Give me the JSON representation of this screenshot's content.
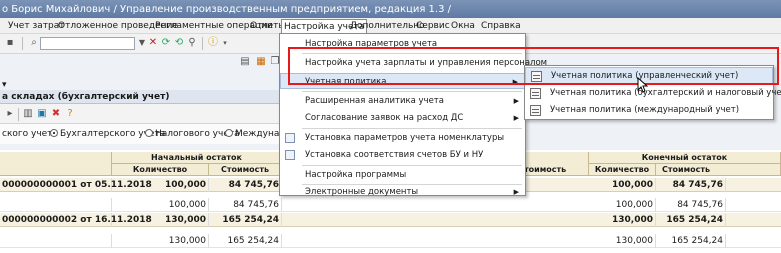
{
  "title_bar": {
    "text": "о Борис Михайлович / Управление производственным предприятием, редакция 1.3 /"
  },
  "menu_bar": {
    "items": [
      "Учет затрат",
      "Отложенное проведение",
      "Регламентные операции",
      "Отчеты",
      "Настройка учета",
      "Дополнительно",
      "Сервис",
      "Окна",
      "Справка"
    ],
    "active": "Настройка учета"
  },
  "toolbar": {
    "search_placeholder": ""
  },
  "window": {
    "title": "а складах (бухгалтерский учет)",
    "radios": {
      "items": [
        "ского учета",
        "Бухгалтерского учета",
        "Налогового учета",
        "Междунаро"
      ],
      "selected": "Бухгалтерского учета"
    }
  },
  "table": {
    "group_headers": {
      "left": "Начальный остаток",
      "right": "Конечный остаток"
    },
    "columns": {
      "qty": "Количество",
      "sum": "Стоимость",
      "sum_partial": "тоимость"
    },
    "rows": [
      {
        "doc": "000000000001 от 05.11.2018",
        "qty_start": "100,000",
        "sum_start": "84 745,76",
        "qty_end": "100,000",
        "sum_end": "84 745,76",
        "group": true
      },
      {
        "doc": "",
        "qty_start": "100,000",
        "sum_start": "84 745,76",
        "qty_end": "100,000",
        "sum_end": "84 745,76",
        "group": false
      },
      {
        "doc": "000000000002 от 16.11.2018",
        "qty_start": "130,000",
        "sum_start": "165 254,24",
        "qty_end": "130,000",
        "sum_end": "165 254,24",
        "group": true
      },
      {
        "doc": "",
        "qty_start": "130,000",
        "sum_start": "165 254,24",
        "qty_end": "130,000",
        "sum_end": "165 254,24",
        "group": false
      }
    ]
  },
  "dropdown_menu": {
    "items": [
      {
        "label": "Настройка параметров учета",
        "submenu": false,
        "icon": false
      },
      {
        "label": "Настройка учета зарплаты и управления персоналом",
        "submenu": false,
        "icon": false
      },
      {
        "label": "Учетная политика",
        "submenu": true,
        "icon": false,
        "highlighted": true
      },
      {
        "label": "Расширенная аналитика учета",
        "submenu": true,
        "icon": false
      },
      {
        "label": "Согласование заявок на расход ДС",
        "submenu": true,
        "icon": false
      },
      {
        "label": "Установка параметров учета номенклатуры",
        "submenu": false,
        "icon": true
      },
      {
        "label": "Установка соответствия счетов БУ и НУ",
        "submenu": false,
        "icon": true
      },
      {
        "label": "Настройка программы",
        "submenu": false,
        "icon": false
      },
      {
        "label": "Электронные документы",
        "submenu": true,
        "icon": false
      }
    ]
  },
  "submenu": {
    "items": [
      {
        "label": "Учетная политика (управленческий учет)",
        "highlighted": true
      },
      {
        "label": "Учетная политика (бухгалтерский и налоговый учет)"
      },
      {
        "label": "Учетная политика (международный учет)"
      }
    ]
  },
  "colors": {
    "highlight_box": "#e8191a",
    "menu_hover": "#dde8f6",
    "table_header": "#f4edd6"
  }
}
